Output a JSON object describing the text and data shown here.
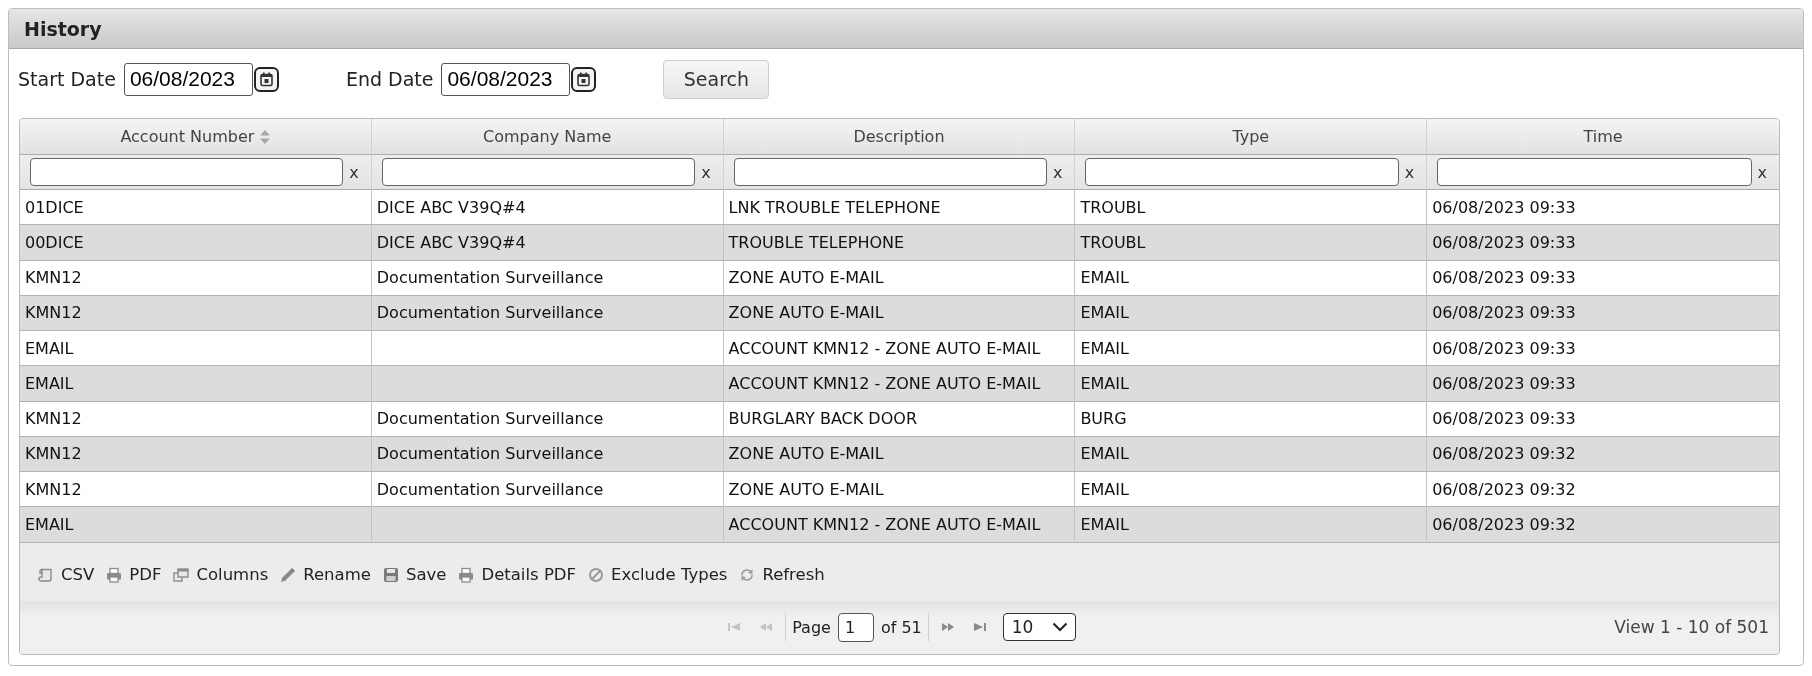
{
  "panel": {
    "title": "History"
  },
  "date_range": {
    "start": {
      "label": "Start Date",
      "value": "06/08/2023"
    },
    "end": {
      "label": "End Date",
      "value": "06/08/2023"
    },
    "search_button": "Search"
  },
  "table": {
    "columns": [
      {
        "label": "Account Number",
        "sortable": true,
        "clear": "x"
      },
      {
        "label": "Company Name",
        "sortable": false,
        "clear": "x"
      },
      {
        "label": "Description",
        "sortable": false,
        "clear": "x"
      },
      {
        "label": "Type",
        "sortable": false,
        "clear": "x"
      },
      {
        "label": "Time",
        "sortable": false,
        "clear": "x"
      }
    ],
    "rows": [
      {
        "account_number": "01DICE",
        "company_name": "DICE ABC V39Q#4",
        "description": "LNK TROUBLE TELEPHONE",
        "type": "TROUBL",
        "time": "06/08/2023 09:33"
      },
      {
        "account_number": "00DICE",
        "company_name": "DICE ABC V39Q#4",
        "description": "TROUBLE TELEPHONE",
        "type": "TROUBL",
        "time": "06/08/2023 09:33"
      },
      {
        "account_number": "KMN12",
        "company_name": "Documentation Surveillance",
        "description": "ZONE AUTO E-MAIL",
        "type": "EMAIL",
        "time": "06/08/2023 09:33"
      },
      {
        "account_number": "KMN12",
        "company_name": "Documentation Surveillance",
        "description": "ZONE AUTO E-MAIL",
        "type": "EMAIL",
        "time": "06/08/2023 09:33"
      },
      {
        "account_number": "EMAIL",
        "description": "ACCOUNT KMN12 - ZONE AUTO E-MAIL",
        "type": "EMAIL",
        "time": "06/08/2023 09:33"
      },
      {
        "account_number": "EMAIL",
        "description": "ACCOUNT KMN12 - ZONE AUTO E-MAIL",
        "type": "EMAIL",
        "time": "06/08/2023 09:33"
      },
      {
        "account_number": "KMN12",
        "company_name": "Documentation Surveillance",
        "description": "BURGLARY BACK DOOR",
        "type": "BURG",
        "time": "06/08/2023 09:33"
      },
      {
        "account_number": "KMN12",
        "company_name": "Documentation Surveillance",
        "description": "ZONE AUTO E-MAIL",
        "type": "EMAIL",
        "time": "06/08/2023 09:32"
      },
      {
        "account_number": "KMN12",
        "company_name": "Documentation Surveillance",
        "description": "ZONE AUTO E-MAIL",
        "type": "EMAIL",
        "time": "06/08/2023 09:32"
      },
      {
        "account_number": "EMAIL",
        "description": "ACCOUNT KMN12 - ZONE AUTO E-MAIL",
        "type": "EMAIL",
        "time": "06/08/2023 09:32"
      }
    ]
  },
  "toolbar": [
    {
      "label": "CSV"
    },
    {
      "label": "PDF"
    },
    {
      "label": "Columns"
    },
    {
      "label": "Rename"
    },
    {
      "label": "Save"
    },
    {
      "label": "Details PDF"
    },
    {
      "label": "Exclude Types"
    },
    {
      "label": "Refresh"
    }
  ],
  "pager": {
    "first": {
      "disabled": true
    },
    "previous": {
      "disabled": true
    },
    "page_label": "Page",
    "page": "1",
    "of_pages": "of 51",
    "next": {
      "disabled": false
    },
    "last": {
      "disabled": false
    },
    "page_size": "10",
    "summary": "View 1 - 10 of 501"
  }
}
